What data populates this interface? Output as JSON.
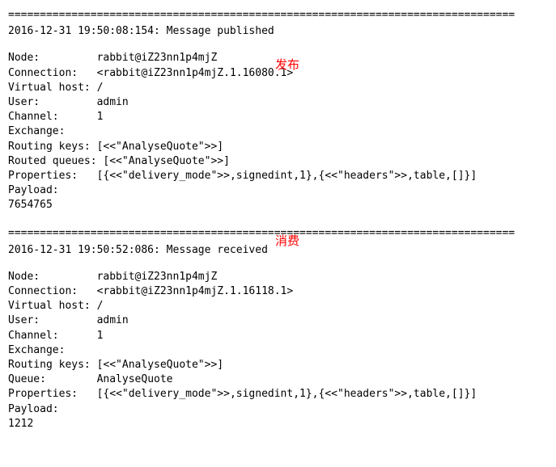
{
  "separator": "================================================================================",
  "section1": {
    "timestamp_line": "2016-12-31 19:50:08:154: Message published",
    "annotation": "发布",
    "fields": {
      "node_label": "Node:         ",
      "node_value": "rabbit@iZ23nn1p4mjZ",
      "connection_label": "Connection:   ",
      "connection_value": "<rabbit@iZ23nn1p4mjZ.1.16080.1>",
      "vhost_label": "Virtual host: ",
      "vhost_value": "/",
      "user_label": "User:         ",
      "user_value": "admin",
      "channel_label": "Channel:      ",
      "channel_value": "1",
      "exchange_label": "Exchange:     ",
      "exchange_value": "",
      "routingkeys_label": "Routing keys: ",
      "routingkeys_value": "[<<\"AnalyseQuote\">>]",
      "routedqueues_label": "Routed queues: ",
      "routedqueues_value": "[<<\"AnalyseQuote\">>]",
      "properties_label": "Properties:   ",
      "properties_value": "[{<<\"delivery_mode\">>,signedint,1},{<<\"headers\">>,table,[]}]",
      "payload_label": "Payload:",
      "payload_value": "7654765"
    }
  },
  "section2": {
    "timestamp_line": "2016-12-31 19:50:52:086: Message received",
    "annotation": "消费",
    "fields": {
      "node_label": "Node:         ",
      "node_value": "rabbit@iZ23nn1p4mjZ",
      "connection_label": "Connection:   ",
      "connection_value": "<rabbit@iZ23nn1p4mjZ.1.16118.1>",
      "vhost_label": "Virtual host: ",
      "vhost_value": "/",
      "user_label": "User:         ",
      "user_value": "admin",
      "channel_label": "Channel:      ",
      "channel_value": "1",
      "exchange_label": "Exchange:     ",
      "exchange_value": "",
      "routingkeys_label": "Routing keys: ",
      "routingkeys_value": "[<<\"AnalyseQuote\">>]",
      "queue_label": "Queue:        ",
      "queue_value": "AnalyseQuote",
      "properties_label": "Properties:   ",
      "properties_value": "[{<<\"delivery_mode\">>,signedint,1},{<<\"headers\">>,table,[]}]",
      "payload_label": "Payload:",
      "payload_value": "1212"
    }
  }
}
